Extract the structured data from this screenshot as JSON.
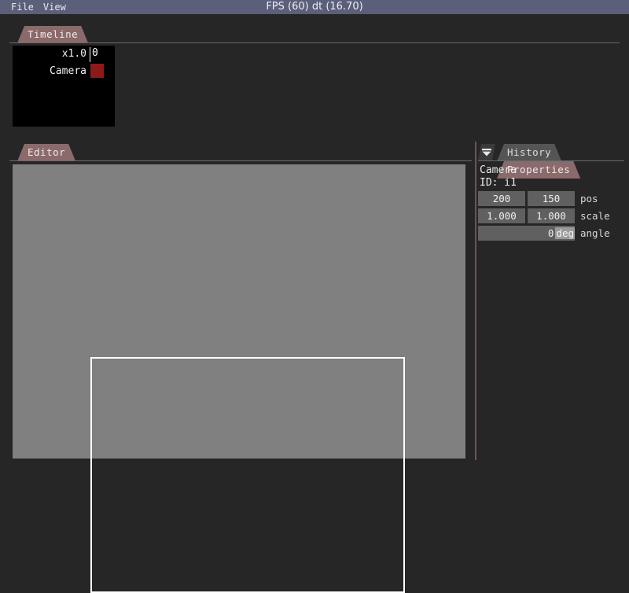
{
  "window": {
    "title": "FPS (60) dt (16.70)",
    "menu": [
      {
        "label": "File"
      },
      {
        "label": "View"
      }
    ]
  },
  "timeline_panel": {
    "tab": {
      "label": "Timeline",
      "state": "active"
    },
    "rows": [
      {
        "label": "x1.0",
        "frame_marker": "0"
      },
      {
        "label": "Camera",
        "keyframe_color": "#8e1a18"
      }
    ],
    "playhead_frame": "0"
  },
  "editor_panel": {
    "tab": {
      "label": "Editor",
      "state": "active"
    },
    "canvas_color": "#808080",
    "selection_rect_color": "#ffffff"
  },
  "right_panel": {
    "filter_icon": "funnel-icon",
    "tabs": [
      {
        "label": "History",
        "state": "inactive"
      },
      {
        "label": "Properties",
        "state": "active"
      }
    ],
    "properties": {
      "object_name": "Camera",
      "object_id": "ID: i1",
      "rows": [
        {
          "label": "pos",
          "fields": [
            "200",
            "150"
          ]
        },
        {
          "label": "scale",
          "fields": [
            "1.000",
            "1.000"
          ]
        },
        {
          "label": "angle",
          "value": "0",
          "unit": "deg"
        }
      ]
    }
  },
  "colors": {
    "menubar": "#5b5f79",
    "background": "#262626",
    "tab_active": "#8a6a6b",
    "tab_inactive": "#555555",
    "divider": "#7a4e4e",
    "field": "#606060"
  }
}
